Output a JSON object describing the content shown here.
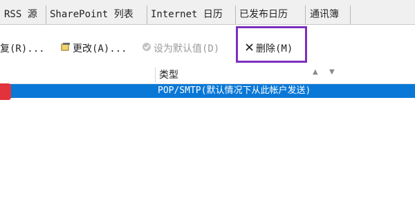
{
  "tabs": [
    {
      "label": "RSS 源"
    },
    {
      "label": "SharePoint 列表"
    },
    {
      "label": "Internet 日历"
    },
    {
      "label": "已发布日历"
    },
    {
      "label": "通讯簿"
    }
  ],
  "toolbar": {
    "repair_label": "修复(R)...",
    "change_label": "更改(A)...",
    "set_default_label": "设为默认值(D)",
    "delete_label": "删除(M)",
    "move_up_icon": "arrow-up-icon",
    "move_down_icon": "arrow-down-icon"
  },
  "table": {
    "columns": [
      "类型"
    ],
    "rows": [
      {
        "type": "POP/SMTP(默认情况下从此帐户发送)",
        "selected": true
      }
    ]
  },
  "colors": {
    "selection": "#0a78d7",
    "highlight_box": "#7b2fbe",
    "account_marker": "#e2323b"
  }
}
